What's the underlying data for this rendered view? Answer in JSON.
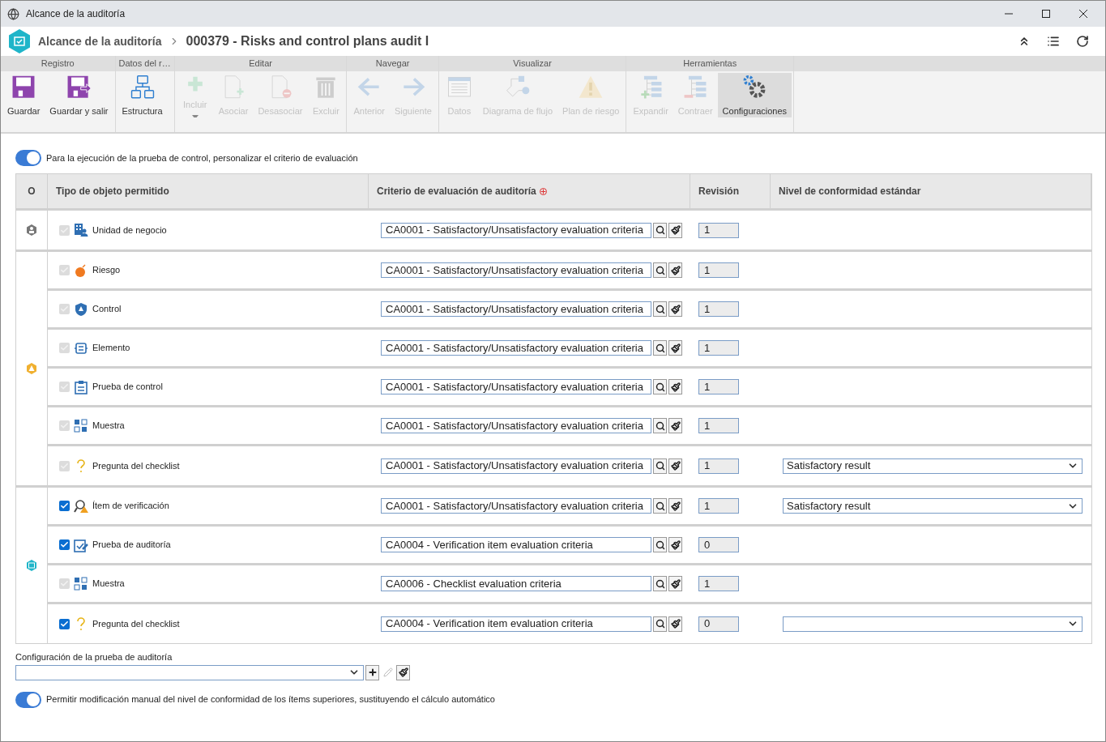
{
  "window": {
    "title": "Alcance de la auditoría"
  },
  "header": {
    "breadcrumb": "Alcance de la auditoría",
    "title": "000379 - Risks and control plans audit I"
  },
  "ribbon": [
    {
      "label": "Registro",
      "buttons": [
        {
          "label": "Guardar",
          "kind": "save",
          "disabled": false,
          "selected": false,
          "menu": false
        },
        {
          "label": "Guardar y salir",
          "kind": "save-exit",
          "disabled": false,
          "selected": false,
          "menu": false
        }
      ]
    },
    {
      "label": "Datos del r…",
      "buttons": [
        {
          "label": "Estructura",
          "kind": "structure",
          "disabled": false,
          "selected": false,
          "menu": false
        }
      ]
    },
    {
      "label": "Editar",
      "buttons": [
        {
          "label": "Incluir",
          "kind": "plus",
          "disabled": true,
          "selected": false,
          "menu": true
        },
        {
          "label": "Asociar",
          "kind": "doc-plus",
          "disabled": true,
          "selected": false,
          "menu": false
        },
        {
          "label": "Desasociar",
          "kind": "doc-minus",
          "disabled": true,
          "selected": false,
          "menu": false
        },
        {
          "label": "Excluir",
          "kind": "trash",
          "disabled": true,
          "selected": false,
          "menu": false
        }
      ]
    },
    {
      "label": "Navegar",
      "buttons": [
        {
          "label": "Anterior",
          "kind": "left",
          "disabled": true,
          "selected": false,
          "menu": false
        },
        {
          "label": "Siguiente",
          "kind": "right",
          "disabled": true,
          "selected": false,
          "menu": false
        }
      ]
    },
    {
      "label": "Visualizar",
      "buttons": [
        {
          "label": "Datos",
          "kind": "data",
          "disabled": true,
          "selected": false,
          "menu": false
        },
        {
          "label": "Diagrama de flujo",
          "kind": "flow",
          "disabled": true,
          "selected": false,
          "menu": false
        },
        {
          "label": "Plan de riesgo",
          "kind": "warning",
          "disabled": true,
          "selected": false,
          "menu": false
        }
      ]
    },
    {
      "label": "Herramientas",
      "buttons": [
        {
          "label": "Expandir",
          "kind": "expand",
          "disabled": true,
          "selected": false,
          "menu": false
        },
        {
          "label": "Contraer",
          "kind": "collapse",
          "disabled": true,
          "selected": false,
          "menu": false
        },
        {
          "label": "Configuraciones",
          "kind": "gears",
          "disabled": false,
          "selected": true,
          "menu": false
        }
      ]
    }
  ],
  "toggle_top": {
    "label": "Para la ejecución de la prueba de control, personalizar el criterio de evaluación",
    "on": true
  },
  "table": {
    "columns": [
      "O",
      "Tipo de objeto permitido",
      "Criterio de evaluación de auditoría",
      "Revisión",
      "Nivel de conformidad estándar"
    ],
    "groups": [
      {
        "kind": "unit",
        "rows": [
          {
            "kind": "unit",
            "label": "Unidad de negocio",
            "checked": true,
            "disabled": true,
            "criterion": "CA0001 - Satisfactory/Unsatisfactory evaluation criteria",
            "revision": "1",
            "conformity_field": false
          }
        ]
      },
      {
        "kind": "risk",
        "rows": [
          {
            "kind": "bomb",
            "label": "Riesgo",
            "checked": true,
            "disabled": true,
            "criterion": "CA0001 - Satisfactory/Unsatisfactory evaluation criteria",
            "revision": "1",
            "conformity_field": false
          },
          {
            "kind": "shield",
            "label": "Control",
            "checked": true,
            "disabled": true,
            "criterion": "CA0001 - Satisfactory/Unsatisfactory evaluation criteria",
            "revision": "1",
            "conformity_field": false
          },
          {
            "kind": "element",
            "label": "Elemento",
            "checked": true,
            "disabled": true,
            "criterion": "CA0001 - Satisfactory/Unsatisfactory evaluation criteria",
            "revision": "1",
            "conformity_field": false
          },
          {
            "kind": "clipboard",
            "label": "Prueba de control",
            "checked": true,
            "disabled": true,
            "criterion": "CA0001 - Satisfactory/Unsatisfactory evaluation criteria",
            "revision": "1",
            "conformity_field": false
          },
          {
            "kind": "sample",
            "label": "Muestra",
            "checked": true,
            "disabled": true,
            "criterion": "CA0001 - Satisfactory/Unsatisfactory evaluation criteria",
            "revision": "1",
            "conformity_field": false
          },
          {
            "kind": "question",
            "label": "Pregunta del checklist",
            "checked": true,
            "disabled": true,
            "criterion": "CA0001 - Satisfactory/Unsatisfactory evaluation criteria",
            "revision": "1",
            "conformity_field": true,
            "conformity": "Satisfactory result"
          }
        ]
      },
      {
        "kind": "audit",
        "rows": [
          {
            "kind": "verify",
            "label": "Ítem de verificación",
            "checked": true,
            "disabled": false,
            "criterion": "CA0001 - Satisfactory/Unsatisfactory evaluation criteria",
            "revision": "1",
            "conformity_field": true,
            "conformity": "Satisfactory result"
          },
          {
            "kind": "audit-test",
            "label": "Prueba de auditoría",
            "checked": true,
            "disabled": false,
            "criterion": "CA0004 - Verification item evaluation criteria",
            "revision": "0",
            "conformity_field": false
          },
          {
            "kind": "sample",
            "label": "Muestra",
            "checked": true,
            "disabled": true,
            "criterion": "CA0006 - Checklist evaluation criteria",
            "revision": "1",
            "conformity_field": false
          },
          {
            "kind": "question",
            "label": "Pregunta del checklist",
            "checked": true,
            "disabled": false,
            "criterion": "CA0004 - Verification item evaluation criteria",
            "revision": "0",
            "conformity_field": true
          }
        ]
      }
    ]
  },
  "config": {
    "label": "Configuración de la prueba de auditoría"
  },
  "toggle_bottom": {
    "label": "Permitir modificación manual del nivel de conformidad de los ítems superiores, sustituyendo el cálculo automático",
    "on": true
  }
}
